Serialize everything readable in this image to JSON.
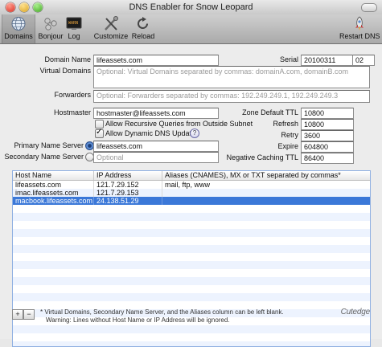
{
  "window": {
    "title": "DNS Enabler for Snow Leopard"
  },
  "toolbar": {
    "domains": "Domains",
    "bonjour": "Bonjour",
    "log": "Log",
    "customize": "Customize",
    "reload": "Reload",
    "restart": "Restart DNS"
  },
  "form": {
    "domain_name_label": "Domain Name",
    "domain_name_value": "lifeassets.com",
    "serial_label": "Serial",
    "serial_value": "20100311",
    "serial_suffix": "02",
    "virtual_domains_label": "Virtual Domains",
    "virtual_domains_placeholder": "Optional: Virtual Domains separated by commas: domainA.com, domainB.com",
    "forwarders_label": "Forwarders",
    "forwarders_placeholder": "Optional: Forwarders separated by commas: 192.249.249.1, 192.249.249.3",
    "hostmaster_label": "Hostmaster",
    "hostmaster_value": "hostmaster@lifeassets.com",
    "zone_ttl_label": "Zone Default TTL",
    "zone_ttl_value": "10800",
    "allow_recursive_label": "Allow Recursive Queries from Outside Subnet",
    "allow_recursive_checked": false,
    "refresh_label": "Refresh",
    "refresh_value": "10800",
    "allow_dynamic_label": "Allow Dynamic DNS Updates",
    "allow_dynamic_checked": true,
    "retry_label": "Retry",
    "retry_value": "3600",
    "primary_ns_label": "Primary Name Server",
    "primary_ns_value": "lifeassets.com",
    "expire_label": "Expire",
    "expire_value": "604800",
    "secondary_ns_label": "Secondary Name Server",
    "secondary_ns_placeholder": "Optional",
    "neg_ttl_label": "Negative Caching TTL",
    "neg_ttl_value": "86400"
  },
  "table": {
    "headers": [
      "Host Name",
      "IP Address",
      "Aliases (CNAMES), MX or TXT separated by commas*"
    ],
    "rows": [
      {
        "host": "lifeassets.com",
        "ip": "121.7.29.152",
        "aliases": "mail, ftp, www"
      },
      {
        "host": "imac.lifeassets.com",
        "ip": "121.7.29.153",
        "aliases": ""
      },
      {
        "host": "macbook.lifeassets.com",
        "ip": "24.138.51.29",
        "aliases": ""
      }
    ],
    "selected_row": 2
  },
  "footer": {
    "add_label": "+",
    "remove_label": "−",
    "note1": "* Virtual Domains, Secondary Name Server, and the Aliases column can be left blank.",
    "note2": "Warning: Lines without Host Name or IP Address will be ignored.",
    "logo": "Cutedge"
  },
  "colors": {
    "selection": "#3b78d8",
    "alt_row": "#edf3fe",
    "table_border": "#8fb0e2"
  }
}
